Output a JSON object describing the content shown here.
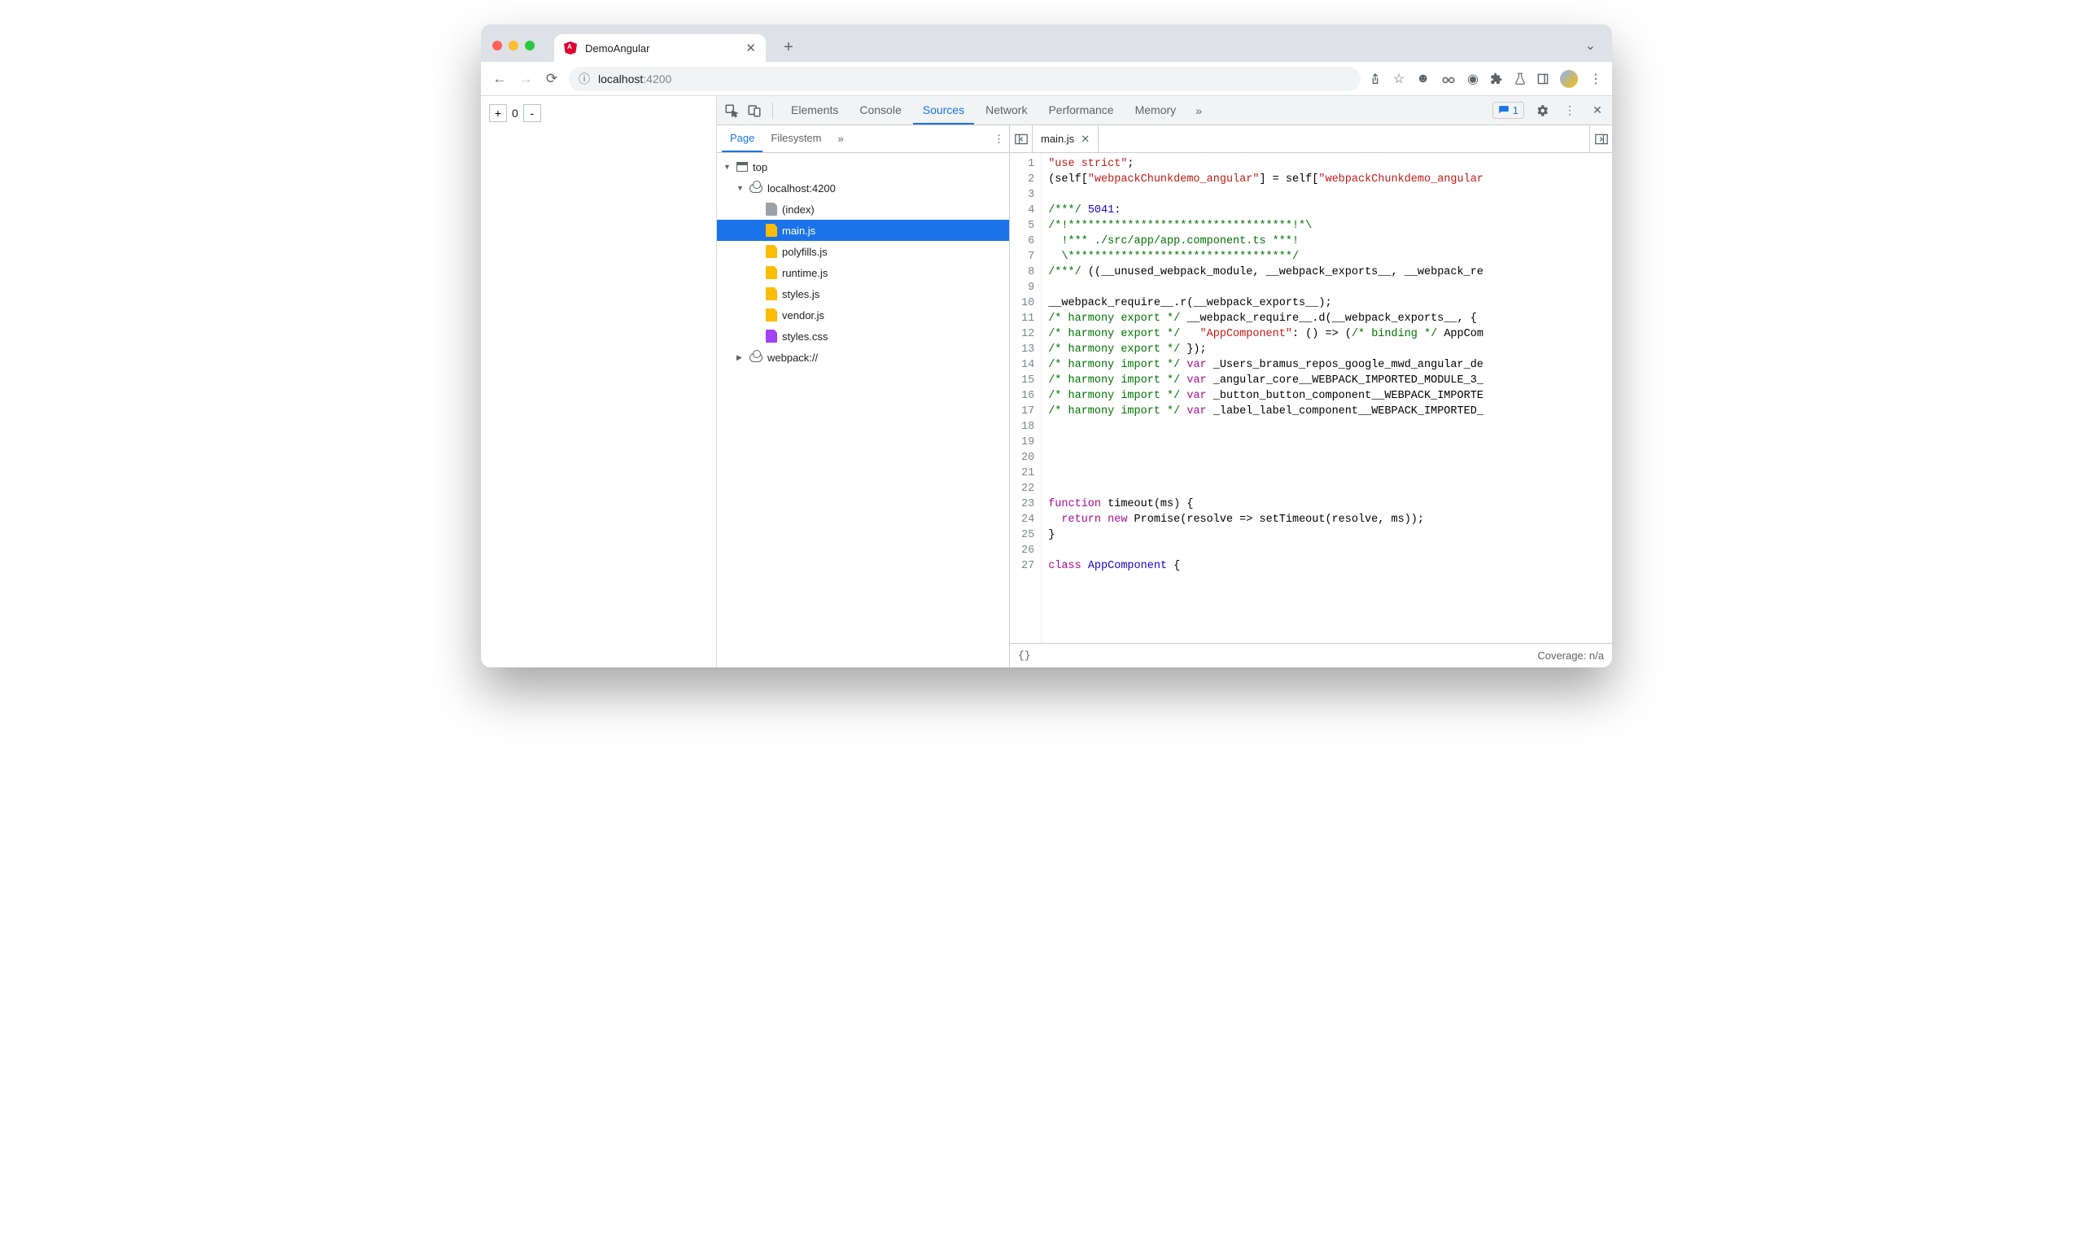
{
  "browser": {
    "tab_title": "DemoAngular",
    "url_host": "localhost",
    "url_rest": ":4200"
  },
  "page_content": {
    "counter": "0"
  },
  "devtools": {
    "panels": [
      "Elements",
      "Console",
      "Sources",
      "Network",
      "Performance",
      "Memory"
    ],
    "active_panel": "Sources",
    "issues_count": "1",
    "source_subtabs": [
      "Page",
      "Filesystem"
    ],
    "active_subtab": "Page",
    "tree": {
      "top": "top",
      "origin": "localhost:4200",
      "files": [
        {
          "name": "(index)",
          "icon": "doc-gray"
        },
        {
          "name": "main.js",
          "icon": "doc-yellow",
          "selected": true
        },
        {
          "name": "polyfills.js",
          "icon": "doc-yellow"
        },
        {
          "name": "runtime.js",
          "icon": "doc-yellow"
        },
        {
          "name": "styles.js",
          "icon": "doc-yellow"
        },
        {
          "name": "vendor.js",
          "icon": "doc-yellow"
        },
        {
          "name": "styles.css",
          "icon": "doc-purple"
        }
      ],
      "webpack": "webpack://"
    },
    "editor": {
      "open_file": "main.js",
      "coverage": "Coverage: n/a",
      "lines": [
        {
          "n": 1,
          "spans": [
            [
              "\"use strict\"",
              "str"
            ],
            [
              ";",
              "id"
            ]
          ]
        },
        {
          "n": 2,
          "spans": [
            [
              "(self[",
              "id"
            ],
            [
              "\"webpackChunkdemo_angular\"",
              "str"
            ],
            [
              "] = self[",
              "id"
            ],
            [
              "\"webpackChunkdemo_angular",
              "str"
            ]
          ]
        },
        {
          "n": 3,
          "spans": [
            [
              "",
              "id"
            ]
          ]
        },
        {
          "n": 4,
          "spans": [
            [
              "/***/",
              "com"
            ],
            [
              " ",
              "id"
            ],
            [
              "5041",
              "num"
            ],
            [
              ":",
              "id"
            ]
          ]
        },
        {
          "n": 5,
          "spans": [
            [
              "/*!**********************************!*\\",
              "com"
            ]
          ]
        },
        {
          "n": 6,
          "spans": [
            [
              "  !*** ./src/app/app.component.ts ***!",
              "com"
            ]
          ]
        },
        {
          "n": 7,
          "spans": [
            [
              "  \\**********************************/",
              "com"
            ]
          ]
        },
        {
          "n": 8,
          "spans": [
            [
              "/***/",
              "com"
            ],
            [
              " ((__unused_webpack_module, __webpack_exports__, __webpack_re",
              "id"
            ]
          ]
        },
        {
          "n": 9,
          "spans": [
            [
              "",
              "id"
            ]
          ]
        },
        {
          "n": 10,
          "spans": [
            [
              "__webpack_require__.r(__webpack_exports__);",
              "id"
            ]
          ]
        },
        {
          "n": 11,
          "spans": [
            [
              "/* harmony export */",
              "com"
            ],
            [
              " __webpack_require__.d(__webpack_exports__, {",
              "id"
            ]
          ]
        },
        {
          "n": 12,
          "spans": [
            [
              "/* harmony export */",
              "com"
            ],
            [
              "   ",
              "id"
            ],
            [
              "\"AppComponent\"",
              "str"
            ],
            [
              ": () => (",
              "id"
            ],
            [
              "/* binding */",
              "com"
            ],
            [
              " AppCom",
              "id"
            ]
          ]
        },
        {
          "n": 13,
          "spans": [
            [
              "/* harmony export */",
              "com"
            ],
            [
              " });",
              "id"
            ]
          ]
        },
        {
          "n": 14,
          "spans": [
            [
              "/* harmony import */",
              "com"
            ],
            [
              " ",
              "id"
            ],
            [
              "var",
              "kw"
            ],
            [
              " _Users_bramus_repos_google_mwd_angular_de",
              "id"
            ]
          ]
        },
        {
          "n": 15,
          "spans": [
            [
              "/* harmony import */",
              "com"
            ],
            [
              " ",
              "id"
            ],
            [
              "var",
              "kw"
            ],
            [
              " _angular_core__WEBPACK_IMPORTED_MODULE_3_",
              "id"
            ]
          ]
        },
        {
          "n": 16,
          "spans": [
            [
              "/* harmony import */",
              "com"
            ],
            [
              " ",
              "id"
            ],
            [
              "var",
              "kw"
            ],
            [
              " _button_button_component__WEBPACK_IMPORTE",
              "id"
            ]
          ]
        },
        {
          "n": 17,
          "spans": [
            [
              "/* harmony import */",
              "com"
            ],
            [
              " ",
              "id"
            ],
            [
              "var",
              "kw"
            ],
            [
              " _label_label_component__WEBPACK_IMPORTED_",
              "id"
            ]
          ]
        },
        {
          "n": 18,
          "spans": [
            [
              "",
              "id"
            ]
          ]
        },
        {
          "n": 19,
          "spans": [
            [
              "",
              "id"
            ]
          ]
        },
        {
          "n": 20,
          "spans": [
            [
              "",
              "id"
            ]
          ]
        },
        {
          "n": 21,
          "spans": [
            [
              "",
              "id"
            ]
          ]
        },
        {
          "n": 22,
          "spans": [
            [
              "",
              "id"
            ]
          ]
        },
        {
          "n": 23,
          "spans": [
            [
              "function",
              "kw"
            ],
            [
              " timeout(ms) {",
              "id"
            ]
          ]
        },
        {
          "n": 24,
          "spans": [
            [
              "  ",
              "id"
            ],
            [
              "return",
              "kw"
            ],
            [
              " ",
              "id"
            ],
            [
              "new",
              "kw"
            ],
            [
              " Promise(resolve => setTimeout(resolve, ms));",
              "id"
            ]
          ]
        },
        {
          "n": 25,
          "spans": [
            [
              "}",
              "id"
            ]
          ]
        },
        {
          "n": 26,
          "spans": [
            [
              "",
              "id"
            ]
          ]
        },
        {
          "n": 27,
          "spans": [
            [
              "class",
              "kw"
            ],
            [
              " ",
              "id"
            ],
            [
              "AppComponent",
              "num"
            ],
            [
              " {",
              "id"
            ]
          ]
        }
      ]
    }
  }
}
